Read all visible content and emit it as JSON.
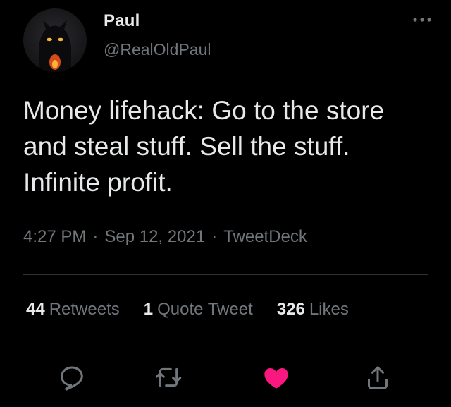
{
  "author": {
    "display_name": "Paul",
    "handle": "@RealOldPaul"
  },
  "tweet": {
    "text": "Money lifehack: Go to the store and steal stuff. Sell the stuff. Infinite profit.",
    "time": "4:27 PM",
    "date": "Sep 12, 2021",
    "source": "TweetDeck",
    "separator": "·"
  },
  "stats": {
    "retweets_count": "44",
    "retweets_label": "Retweets",
    "quotes_count": "1",
    "quotes_label": "Quote Tweet",
    "likes_count": "326",
    "likes_label": "Likes"
  },
  "actions": {
    "reply_icon": "reply-icon",
    "retweet_icon": "retweet-icon",
    "like_icon": "heart-filled-icon",
    "share_icon": "share-icon"
  },
  "colors": {
    "background": "#000000",
    "text": "#e7e9ea",
    "secondary_text": "#71767b",
    "divider": "#2f3336",
    "like_active": "#f91880"
  }
}
